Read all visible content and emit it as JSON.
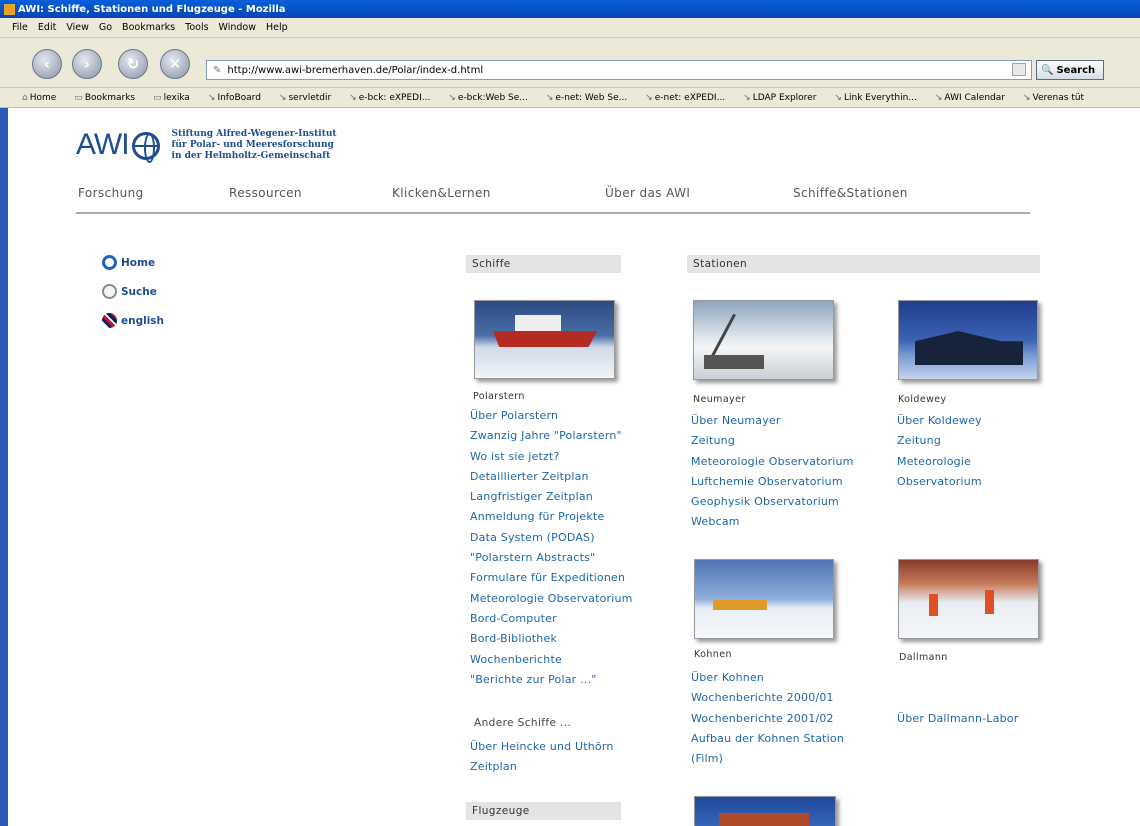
{
  "window": {
    "title": "AWI: Schiffe, Stationen und Flugzeuge - Mozilla"
  },
  "menu": [
    "File",
    "Edit",
    "View",
    "Go",
    "Bookmarks",
    "Tools",
    "Window",
    "Help"
  ],
  "address": {
    "url": "http://www.awi-bremerhaven.de/Polar/index-d.html",
    "search_label": "Search"
  },
  "bookmarks": [
    "Home",
    "Bookmarks",
    "lexika",
    "InfoBoard",
    "servletdir",
    "e-bck: eXPEDI...",
    "e-bck:Web Se...",
    "e-net: Web Se...",
    "e-net: eXPEDI...",
    "LDAP Explorer",
    "Link Everythin...",
    "AWI Calendar",
    "Verenas tüt"
  ],
  "logo": {
    "text": "AWI",
    "org_line1": "Stiftung Alfred-Wegener-Institut",
    "org_line2": "für Polar- und Meeresforschung",
    "org_line3": "in der Helmholtz-Gemeinschaft"
  },
  "nav": [
    "Forschung",
    "Ressourcen",
    "Klicken&Lernen",
    "Über das AWI",
    "Schiffe&Stationen"
  ],
  "side": {
    "home": "Home",
    "search": "Suche",
    "english": "english"
  },
  "schiffe": {
    "heading": "Schiffe",
    "caption": "Polarstern",
    "links": [
      "Über Polarstern",
      "Zwanzig Jahre \"Polarstern\"",
      "Wo ist sie jetzt?",
      "Detaillierter Zeitplan",
      "Langfristiger Zeitplan",
      "Anmeldung für Projekte",
      "Data System (PODAS)",
      "\"Polarstern Abstracts\"",
      "Formulare für Expeditionen",
      "Meteorologie Observatorium",
      "Bord-Computer",
      "Bord-Bibliothek",
      "Wochenberichte",
      "\"Berichte zur Polar ...\""
    ],
    "other_heading": "Andere Schiffe ...",
    "other_links": [
      "Über Heincke und Uthörn",
      "Zeitplan"
    ],
    "flugzeuge_heading": "Flugzeuge"
  },
  "stationen": {
    "heading": "Stationen",
    "neumayer": {
      "caption": "Neumayer",
      "links": [
        "Über Neumayer",
        "Zeitung",
        "Meteorologie Observatorium",
        "Luftchemie Observatorium",
        "Geophysik Observatorium",
        "Webcam"
      ]
    },
    "koldewey": {
      "caption": "Koldewey",
      "links": [
        "Über Koldewey",
        "Zeitung",
        "Meteorologie",
        "Observatorium"
      ]
    },
    "kohnen": {
      "caption": "Kohnen",
      "links": [
        "Über Kohnen",
        "Wochenberichte 2000/01",
        "Wochenberichte 2001/02",
        "Aufbau der Kohnen Station",
        "(Film)"
      ]
    },
    "dallmann": {
      "caption": "Dallmann",
      "links": [
        "Über Dallmann-Labor"
      ]
    }
  }
}
